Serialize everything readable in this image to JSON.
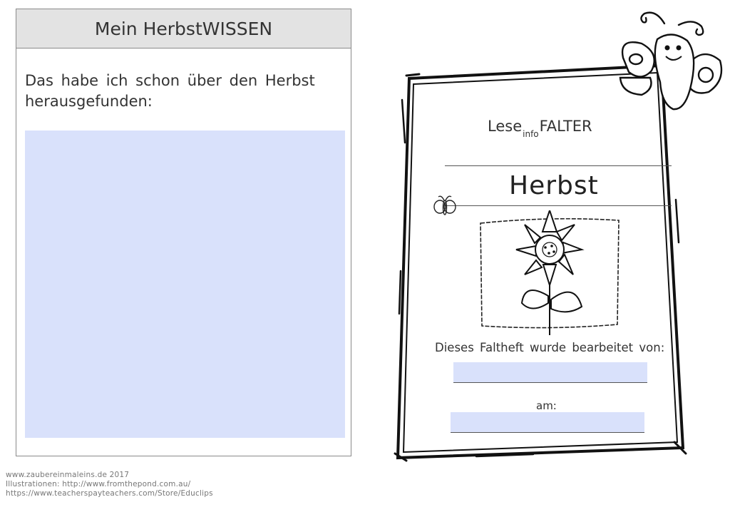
{
  "left": {
    "header": "Mein HerbstWISSEN",
    "prompt": "Das habe ich schon über den Herbst herausgefunden:"
  },
  "card": {
    "brand_prefix": "Lese",
    "brand_sup": "info",
    "brand_suffix": "FALTER",
    "title": "Herbst",
    "made_by": "Dieses Faltheft wurde bearbeitet von:",
    "date_label": "am:"
  },
  "footer": {
    "line1": "www.zaubereinmaleins.de  2017",
    "line2": "Illustrationen:  http://www.fromthepond.com.au/",
    "line3": "https://www.teacherspayteachers.com/Store/Educlips"
  },
  "colors": {
    "answer_fill": "#d9e1fb",
    "header_fill": "#e3e3e3"
  },
  "icons": [
    "butterfly-icon",
    "small-butterfly-icon",
    "sunflower-icon"
  ]
}
